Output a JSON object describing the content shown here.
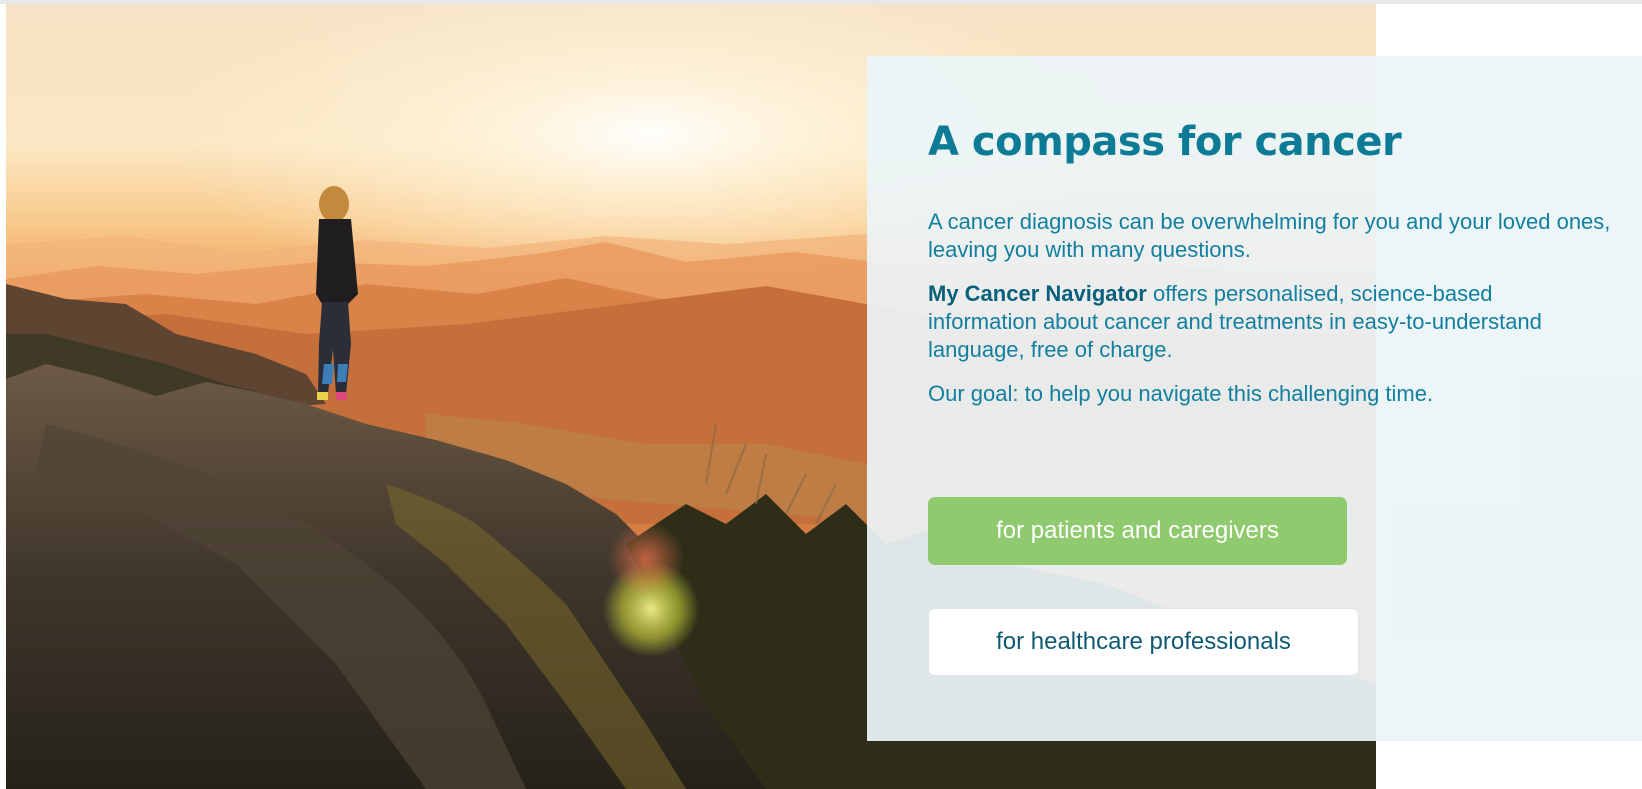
{
  "hero": {
    "headline": "A compass for cancer",
    "intro": "A cancer diagnosis can be overwhelming for you and your loved ones, leaving you with many questions.",
    "offer_brand": "My Cancer Navigator",
    "offer_rest": " offers personalised, science-based information about cancer and treatments in easy-to-understand language, free of charge.",
    "goal": "Our goal: to help you navigate this challenging time."
  },
  "cta": {
    "patients_label": "for patients and caregivers",
    "professionals_label": "for healthcare professionals"
  },
  "colors": {
    "heading": "#0d7b95",
    "text": "#137fa0",
    "patients_button": "#8fca6e",
    "professionals_text": "#0e5a73"
  }
}
